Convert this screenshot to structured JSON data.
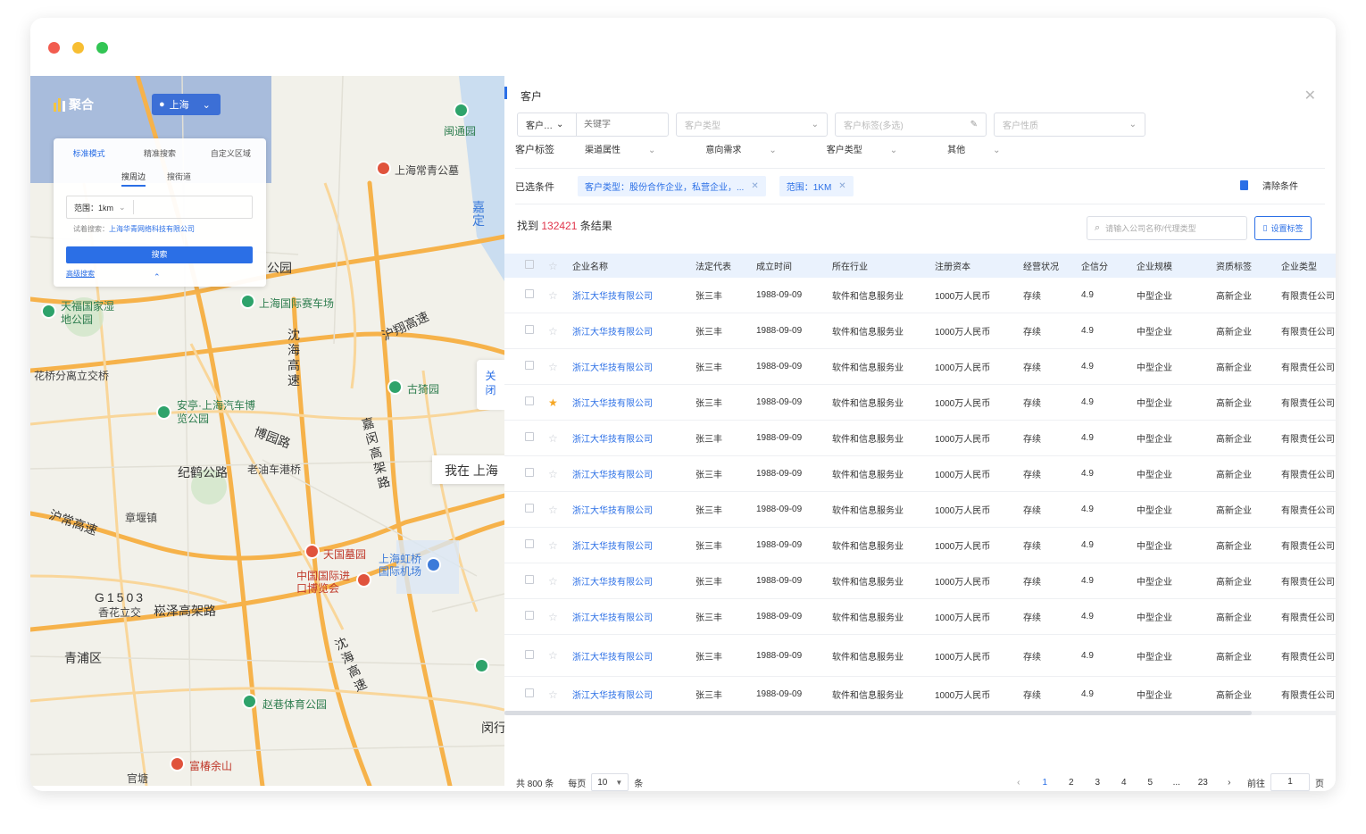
{
  "window": {
    "dot_colors": [
      "#f25c4f",
      "#f7be32",
      "#32c554"
    ]
  },
  "map": {
    "logo": "聚合",
    "city": "上海",
    "search": {
      "modes": [
        "标准模式",
        "精准搜索",
        "自定义区域"
      ],
      "subtabs": [
        "搜周边",
        "搜街道"
      ],
      "range_label": "范围：1km",
      "try_label": "试着搜索：",
      "try_value": "上海华青网络科技有限公司",
      "button": "搜索",
      "advanced": "高级搜索"
    },
    "close_side": [
      "关",
      "闭"
    ],
    "location_bubble": "我在 上海",
    "labels": {
      "gongyuan": "公园",
      "changqing": "上海常青公墓",
      "minhang_yuan": "闽通园",
      "tianfu": "天福国家湿地公园",
      "saiche": "上海国际赛车场",
      "huyu": "沪翔高速",
      "shenhai": "沈海高速",
      "huaqiao": "花桥分离立交桥",
      "anting": "安亭·上海汽车博览公园",
      "guyi": "古猗园",
      "jiamin": "嘉闵高架路",
      "boyuan": "博园路",
      "jihe": "纪鹤公路",
      "laoyou": "老油车港桥",
      "huchang": "沪常高速",
      "zhangyan": "章堰镇",
      "tianguo": "天国墓园",
      "hongqiao": "上海虹桥国际机场",
      "guozhan": "中国国际进口博览会",
      "g1503": "G1503",
      "xianghua": "香花立交",
      "songze": "崧泽高架路",
      "qingpu": "青浦区",
      "shenhai2": "沈海高速",
      "zhaoxiang": "赵巷体育公园",
      "minhang": "闵行",
      "fushou": "富椿余山",
      "guantang": "官塘",
      "jiading": "嘉定"
    }
  },
  "panel": {
    "title": "客户",
    "filters": [
      {
        "value": "客户…",
        "placeholder": "关键字"
      },
      {
        "placeholder": "客户类型"
      },
      {
        "placeholder": "客户标签(多选)"
      },
      {
        "placeholder": "客户性质"
      }
    ],
    "tag_label": "客户标签",
    "dropdowns": [
      "渠道属性",
      "意向需求",
      "客户类型",
      "其他"
    ],
    "selected_label": "已选条件",
    "chips": [
      "客户类型：股份合作企业，私营企业，...",
      "范围：1KM"
    ],
    "clear": "清除条件",
    "found_prefix": "找到",
    "found_count": "132421",
    "found_suffix": "条结果",
    "search_placeholder": "请输入公司名称/代理类型",
    "set_tag": "设置标签",
    "columns": [
      "企业名称",
      "法定代表",
      "成立时间",
      "所在行业",
      "注册资本",
      "经营状况",
      "企信分",
      "企业规模",
      "资质标签",
      "企业类型"
    ],
    "rows": [
      {
        "name": "浙江大华技有限公司",
        "rep": "张三丰",
        "date": "1988-09-09",
        "industry": "软件和信息服务业",
        "capital": "1000万人民币",
        "status": "存续",
        "score": "4.9",
        "scale": "中型企业",
        "tag": "高新企业",
        "type": "有限责任公司",
        "starred": false
      },
      {
        "name": "浙江大华技有限公司",
        "rep": "张三丰",
        "date": "1988-09-09",
        "industry": "软件和信息服务业",
        "capital": "1000万人民币",
        "status": "存续",
        "score": "4.9",
        "scale": "中型企业",
        "tag": "高新企业",
        "type": "有限责任公司",
        "starred": false
      },
      {
        "name": "浙江大华技有限公司",
        "rep": "张三丰",
        "date": "1988-09-09",
        "industry": "软件和信息服务业",
        "capital": "1000万人民币",
        "status": "存续",
        "score": "4.9",
        "scale": "中型企业",
        "tag": "高新企业",
        "type": "有限责任公司",
        "starred": false
      },
      {
        "name": "浙江大华技有限公司",
        "rep": "张三丰",
        "date": "1988-09-09",
        "industry": "软件和信息服务业",
        "capital": "1000万人民币",
        "status": "存续",
        "score": "4.9",
        "scale": "中型企业",
        "tag": "高新企业",
        "type": "有限责任公司",
        "starred": true
      },
      {
        "name": "浙江大华技有限公司",
        "rep": "张三丰",
        "date": "1988-09-09",
        "industry": "软件和信息服务业",
        "capital": "1000万人民币",
        "status": "存续",
        "score": "4.9",
        "scale": "中型企业",
        "tag": "高新企业",
        "type": "有限责任公司",
        "starred": false
      },
      {
        "name": "浙江大华技有限公司",
        "rep": "张三丰",
        "date": "1988-09-09",
        "industry": "软件和信息服务业",
        "capital": "1000万人民币",
        "status": "存续",
        "score": "4.9",
        "scale": "中型企业",
        "tag": "高新企业",
        "type": "有限责任公司",
        "starred": false
      },
      {
        "name": "浙江大华技有限公司",
        "rep": "张三丰",
        "date": "1988-09-09",
        "industry": "软件和信息服务业",
        "capital": "1000万人民币",
        "status": "存续",
        "score": "4.9",
        "scale": "中型企业",
        "tag": "高新企业",
        "type": "有限责任公司",
        "starred": false
      },
      {
        "name": "浙江大华技有限公司",
        "rep": "张三丰",
        "date": "1988-09-09",
        "industry": "软件和信息服务业",
        "capital": "1000万人民币",
        "status": "存续",
        "score": "4.9",
        "scale": "中型企业",
        "tag": "高新企业",
        "type": "有限责任公司",
        "starred": false
      },
      {
        "name": "浙江大华技有限公司",
        "rep": "张三丰",
        "date": "1988-09-09",
        "industry": "软件和信息服务业",
        "capital": "1000万人民币",
        "status": "存续",
        "score": "4.9",
        "scale": "中型企业",
        "tag": "高新企业",
        "type": "有限责任公司",
        "starred": false
      },
      {
        "name": "浙江大华技有限公司",
        "rep": "张三丰",
        "date": "1988-09-09",
        "industry": "软件和信息服务业",
        "capital": "1000万人民币",
        "status": "存续",
        "score": "4.9",
        "scale": "中型企业",
        "tag": "高新企业",
        "type": "有限责任公司",
        "starred": false
      },
      {
        "name": "浙江大华技有限公司",
        "rep": "张三丰",
        "date": "1988-09-09",
        "industry": "软件和信息服务业",
        "capital": "1000万人民币",
        "status": "存续",
        "score": "4.9",
        "scale": "中型企业",
        "tag": "高新企业",
        "type": "有限责任公司",
        "starred": false
      },
      {
        "name": "浙江大华技有限公司",
        "rep": "张三丰",
        "date": "1988-09-09",
        "industry": "软件和信息服务业",
        "capital": "1000万人民币",
        "status": "存续",
        "score": "4.9",
        "scale": "中型企业",
        "tag": "高新企业",
        "type": "有限责任公司",
        "starred": false
      }
    ],
    "pagination": {
      "total": "共 800 条",
      "per_page_label": "每页",
      "per_page": "10",
      "unit": "条",
      "pages": [
        "1",
        "2",
        "3",
        "4",
        "5",
        "...",
        "23"
      ],
      "goto_label": "前往",
      "goto_value": "1",
      "page_unit": "页"
    }
  }
}
